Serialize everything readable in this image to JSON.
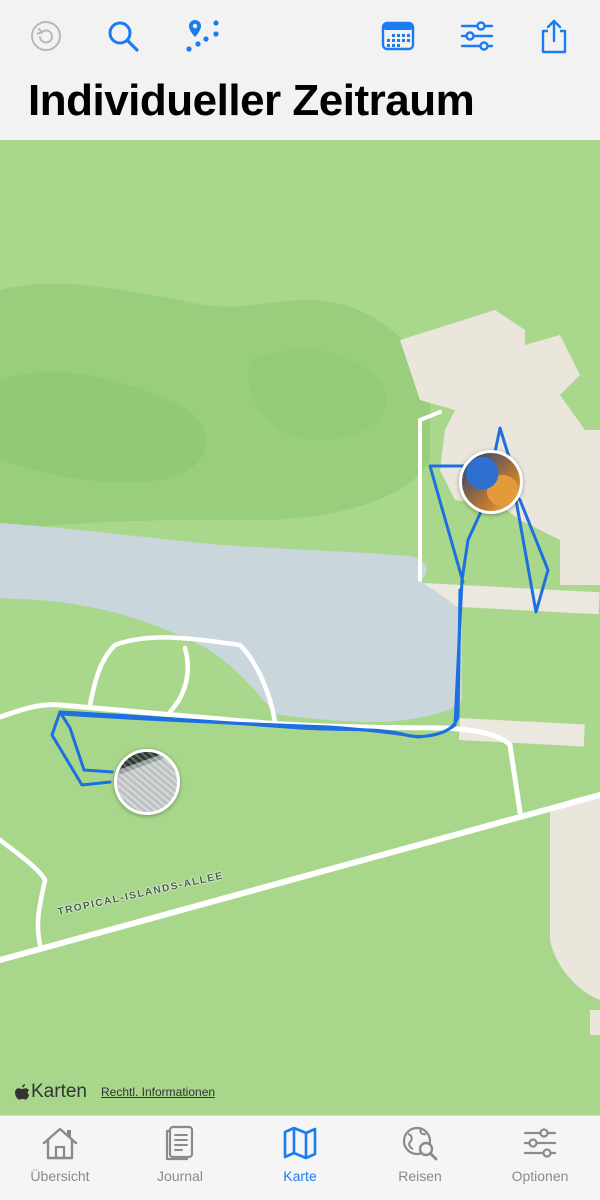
{
  "header": {
    "title": "Individueller Zeitraum",
    "toolbar": [
      {
        "name": "refresh-icon",
        "color": "#b8b8b8"
      },
      {
        "name": "search-icon",
        "color": "#1a7cf0"
      },
      {
        "name": "route-icon",
        "color": "#1a7cf0"
      },
      {
        "name": "calendar-icon",
        "color": "#1a7cf0"
      },
      {
        "name": "filter-sliders-icon",
        "color": "#1a7cf0"
      },
      {
        "name": "share-icon",
        "color": "#1a7cf0"
      }
    ]
  },
  "map": {
    "street_label": "TROPICAL-ISLANDS-ALLEE",
    "track_color": "#1e6fe0",
    "attribution": {
      "logo_text": "Karten",
      "legal_link": "Rechtl. Informationen"
    }
  },
  "tabs": [
    {
      "label": "Übersicht",
      "icon": "house-icon",
      "active": false
    },
    {
      "label": "Journal",
      "icon": "journal-icon",
      "active": false
    },
    {
      "label": "Karte",
      "icon": "map-icon",
      "active": true
    },
    {
      "label": "Reisen",
      "icon": "globe-search-icon",
      "active": false
    },
    {
      "label": "Optionen",
      "icon": "sliders-icon",
      "active": false
    }
  ],
  "colors": {
    "accent": "#1a7cf0",
    "inactive": "#8a8a8a"
  }
}
